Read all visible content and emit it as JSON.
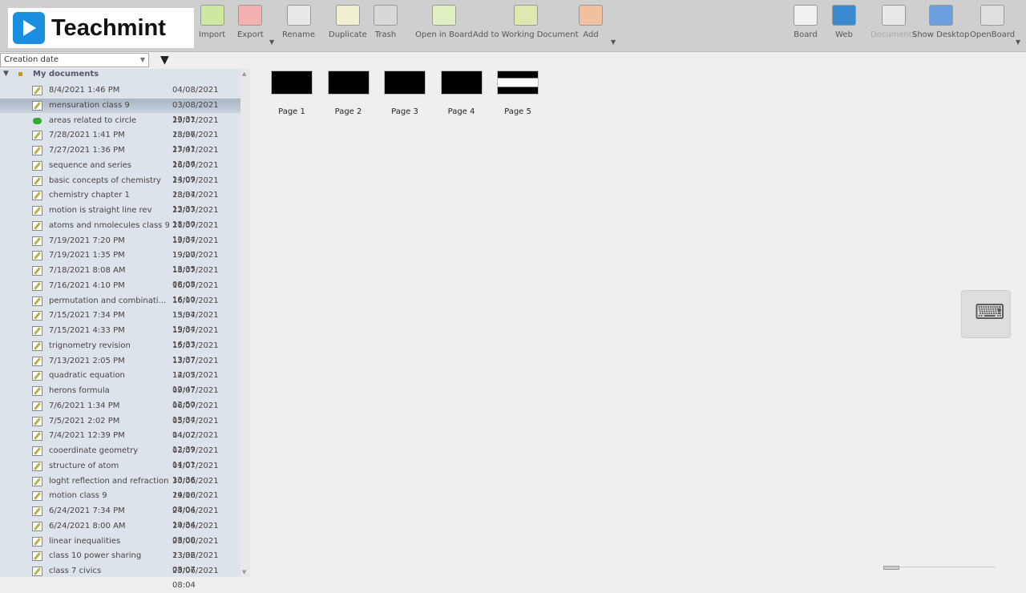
{
  "brand": "Teachmint",
  "toolbar": {
    "left": [
      {
        "label": "Import",
        "icon": "import-icon",
        "color": "#cfe8a0"
      },
      {
        "label": "Export",
        "icon": "export-icon",
        "color": "#f4b0b0"
      },
      {
        "label": "Rename",
        "icon": "rename-icon",
        "color": "#e8e8e8"
      },
      {
        "label": "Duplicate",
        "icon": "duplicate-icon",
        "color": "#f0f0d0"
      },
      {
        "label": "Trash",
        "icon": "trash-icon",
        "color": "#d8d8d8"
      },
      {
        "label": "Open in Board",
        "icon": "open-in-board-icon",
        "color": "#e0f0c0"
      },
      {
        "label": "Add to Working Document",
        "icon": "add-to-working-document-icon",
        "color": "#e0e8b0"
      },
      {
        "label": "Add",
        "icon": "add-icon",
        "color": "#f0c0a0"
      }
    ],
    "right": [
      {
        "label": "Board",
        "icon": "board-icon",
        "color": "#f0f0f0"
      },
      {
        "label": "Web",
        "icon": "globe-icon",
        "color": "#3a8ad0"
      },
      {
        "label": "Documents",
        "icon": "folder-icon",
        "color": "#e8e8e8",
        "disabled": true
      },
      {
        "label": "Show Desktop",
        "icon": "monitor-icon",
        "color": "#6aa0e0"
      },
      {
        "label": "OpenBoard",
        "icon": "gear-icon",
        "color": "#e0e0e0"
      }
    ]
  },
  "sort": {
    "selected": "Creation date"
  },
  "tree": {
    "root": "My documents",
    "items": [
      [
        "8/4/2021 1:46 PM",
        "04/08/2021 13:46"
      ],
      [
        "mensuration class 9",
        "03/08/2021 13:31"
      ],
      [
        "areas related to circle",
        "29/07/2021 13:36"
      ],
      [
        "7/28/2021 1:41 PM",
        "28/07/2021 13:41"
      ],
      [
        "7/27/2021 1:36 PM",
        "27/07/2021 13:36"
      ],
      [
        "sequence and series",
        "26/07/2021 14:09"
      ],
      [
        "basic concepts of chemistry",
        "23/07/2021 18:34"
      ],
      [
        "chemistry chapter 1",
        "23/07/2021 13:33"
      ],
      [
        "motion is straight line rev",
        "22/07/2021 18:30"
      ],
      [
        "atoms and nmolecules class 9",
        "21/07/2021 13:34"
      ],
      [
        "7/19/2021 7:20 PM",
        "19/07/2021 19:20"
      ],
      [
        "7/19/2021 1:35 PM",
        "19/07/2021 13:35"
      ],
      [
        "7/18/2021 8:08 AM",
        "18/07/2021 08:08"
      ],
      [
        "7/16/2021 4:10 PM",
        "16/07/2021 16:10"
      ],
      [
        "permutation and combinati...",
        "16/07/2021 13:34"
      ],
      [
        "7/15/2021 7:34 PM",
        "15/07/2021 19:34"
      ],
      [
        "7/15/2021 4:33 PM",
        "15/07/2021 16:33"
      ],
      [
        "trignometry revision",
        "15/07/2021 13:37"
      ],
      [
        "7/13/2021 2:05 PM",
        "13/07/2021 14:05"
      ],
      [
        "quadratic equation",
        "12/07/2021 12:47"
      ],
      [
        "herons formula",
        "09/07/2021 12:50"
      ],
      [
        "7/6/2021 1:34 PM",
        "06/07/2021 13:34"
      ],
      [
        "7/5/2021 2:02 PM",
        "05/07/2021 14:02"
      ],
      [
        "7/4/2021 12:39 PM",
        "04/07/2021 12:39"
      ],
      [
        "cooerdinate geometry",
        "03/07/2021 14:01"
      ],
      [
        "structure of atom",
        "01/07/2021 13:36"
      ],
      [
        "loght reflection and refraction",
        "30/06/2021 14:10"
      ],
      [
        "motion class 9",
        "29/06/2021 08:04"
      ],
      [
        "6/24/2021 7:34 PM",
        "24/06/2021 19:34"
      ],
      [
        "6/24/2021 8:00 AM",
        "24/06/2021 08:00"
      ],
      [
        "linear inequalities",
        "23/06/2021 13:32"
      ],
      [
        "class 10 power sharing",
        "23/06/2021 08:07"
      ],
      [
        "class 7 civics",
        "23/06/2021 08:04"
      ]
    ],
    "selected_index": 1,
    "arrow_index": 2
  },
  "pages": [
    "Page 1",
    "Page 2",
    "Page 3",
    "Page 4",
    "Page 5"
  ]
}
